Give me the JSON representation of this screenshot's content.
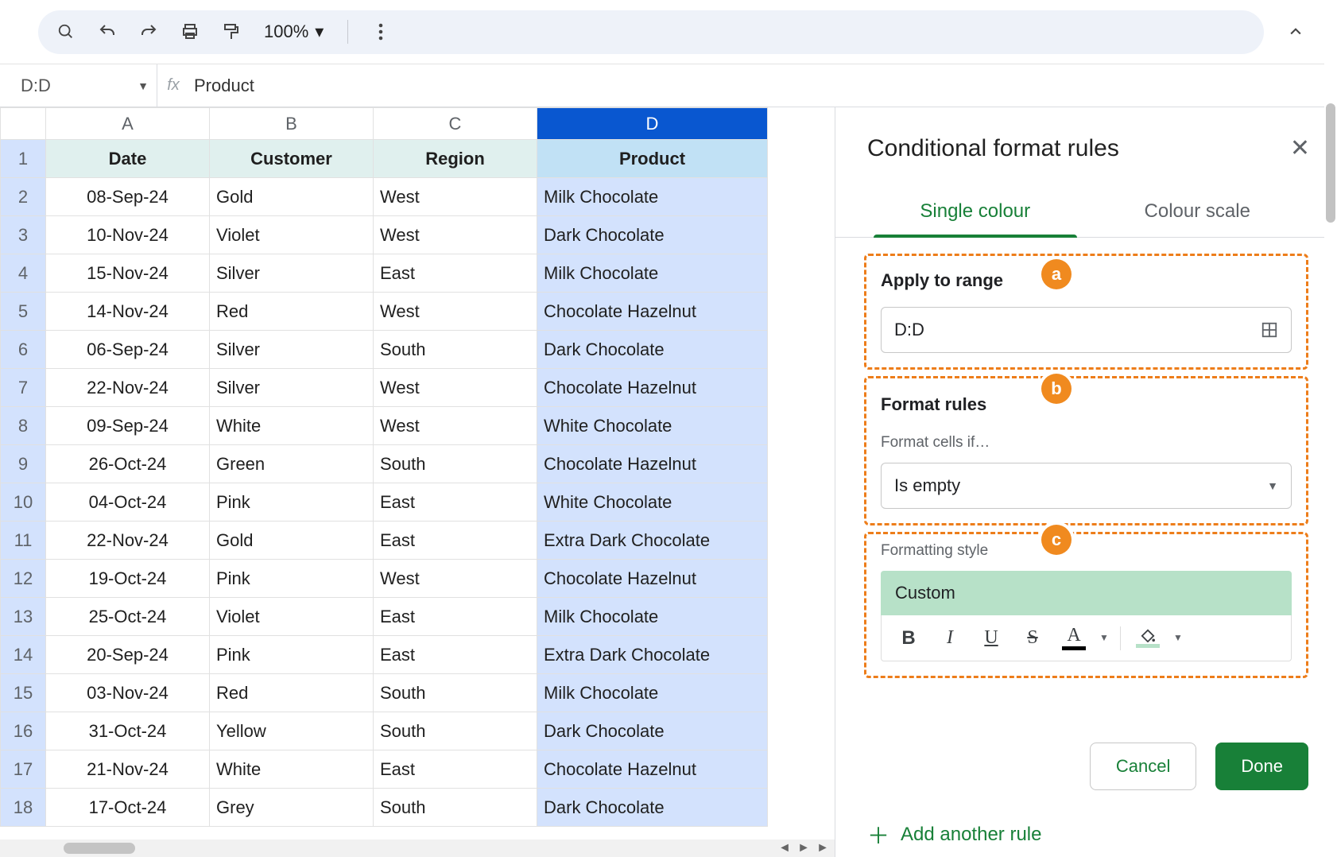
{
  "toolbar": {
    "zoom": "100%"
  },
  "namebox": {
    "ref": "D:D"
  },
  "formula_value": "Product",
  "columns": [
    "A",
    "B",
    "C",
    "D"
  ],
  "header_row": [
    "Date",
    "Customer",
    "Region",
    "Product"
  ],
  "rows": [
    {
      "n": 1
    },
    {
      "n": 2,
      "date": "08-Sep-24",
      "customer": "Gold",
      "region": "West",
      "product": "Milk Chocolate"
    },
    {
      "n": 3,
      "date": "10-Nov-24",
      "customer": "Violet",
      "region": "West",
      "product": "Dark Chocolate"
    },
    {
      "n": 4,
      "date": "15-Nov-24",
      "customer": "Silver",
      "region": "East",
      "product": "Milk Chocolate"
    },
    {
      "n": 5,
      "date": "14-Nov-24",
      "customer": "Red",
      "region": "West",
      "product": "Chocolate Hazelnut"
    },
    {
      "n": 6,
      "date": "06-Sep-24",
      "customer": "Silver",
      "region": "South",
      "product": "Dark Chocolate"
    },
    {
      "n": 7,
      "date": "22-Nov-24",
      "customer": "Silver",
      "region": "West",
      "product": "Chocolate Hazelnut"
    },
    {
      "n": 8,
      "date": "09-Sep-24",
      "customer": "White",
      "region": "West",
      "product": "White Chocolate"
    },
    {
      "n": 9,
      "date": "26-Oct-24",
      "customer": "Green",
      "region": "South",
      "product": "Chocolate Hazelnut"
    },
    {
      "n": 10,
      "date": "04-Oct-24",
      "customer": "Pink",
      "region": "East",
      "product": "White Chocolate"
    },
    {
      "n": 11,
      "date": "22-Nov-24",
      "customer": "Gold",
      "region": "East",
      "product": "Extra Dark Chocolate"
    },
    {
      "n": 12,
      "date": "19-Oct-24",
      "customer": "Pink",
      "region": "West",
      "product": "Chocolate Hazelnut"
    },
    {
      "n": 13,
      "date": "25-Oct-24",
      "customer": "Violet",
      "region": "East",
      "product": "Milk Chocolate"
    },
    {
      "n": 14,
      "date": "20-Sep-24",
      "customer": "Pink",
      "region": "East",
      "product": "Extra Dark Chocolate"
    },
    {
      "n": 15,
      "date": "03-Nov-24",
      "customer": "Red",
      "region": "South",
      "product": "Milk Chocolate"
    },
    {
      "n": 16,
      "date": "31-Oct-24",
      "customer": "Yellow",
      "region": "South",
      "product": "Dark Chocolate"
    },
    {
      "n": 17,
      "date": "21-Nov-24",
      "customer": "White",
      "region": "East",
      "product": "Chocolate Hazelnut"
    },
    {
      "n": 18,
      "date": "17-Oct-24",
      "customer": "Grey",
      "region": "South",
      "product": "Dark Chocolate"
    }
  ],
  "sidebar": {
    "title": "Conditional format rules",
    "tabs": {
      "single": "Single colour",
      "scale": "Colour scale"
    },
    "apply_label": "Apply to range",
    "range_value": "D:D",
    "format_rules_label": "Format rules",
    "cells_if_label": "Format cells if…",
    "cells_if_value": "Is empty",
    "formatting_style_label": "Formatting style",
    "style_name": "Custom",
    "cancel": "Cancel",
    "done": "Done",
    "add_rule": "Add another rule",
    "badges": {
      "a": "a",
      "b": "b",
      "c": "c"
    }
  }
}
